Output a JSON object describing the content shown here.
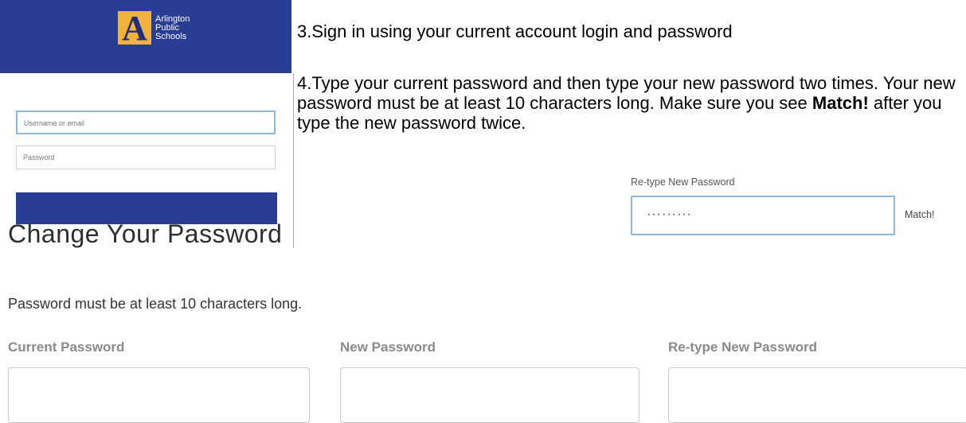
{
  "login": {
    "logo_letter": "A",
    "logo_text": "Arlington Public Schools",
    "username_placeholder": "Username or email",
    "password_placeholder": "Password"
  },
  "instructions": {
    "step3": "3.Sign in using your current account login and password",
    "step4_part1": "4.Type your current password and then type your new password two times.  Your new password must be at least 10 characters long.  Make sure you see ",
    "step4_bold": "Match!",
    "step4_part2": " after you type the new password twice."
  },
  "inset": {
    "label": "Re-type New Password",
    "masked_value": "·········",
    "match_text": "Match!"
  },
  "form": {
    "title": "Change Your Password",
    "note": "Password must be at least 10 characters long.",
    "fields": [
      {
        "label": "Current Password"
      },
      {
        "label": "New Password"
      },
      {
        "label": "Re-type New Password"
      }
    ]
  },
  "colors": {
    "brand_blue": "#2a3d95",
    "logo_gold": "#f2b33d",
    "focus_border": "#8fb7d9"
  }
}
